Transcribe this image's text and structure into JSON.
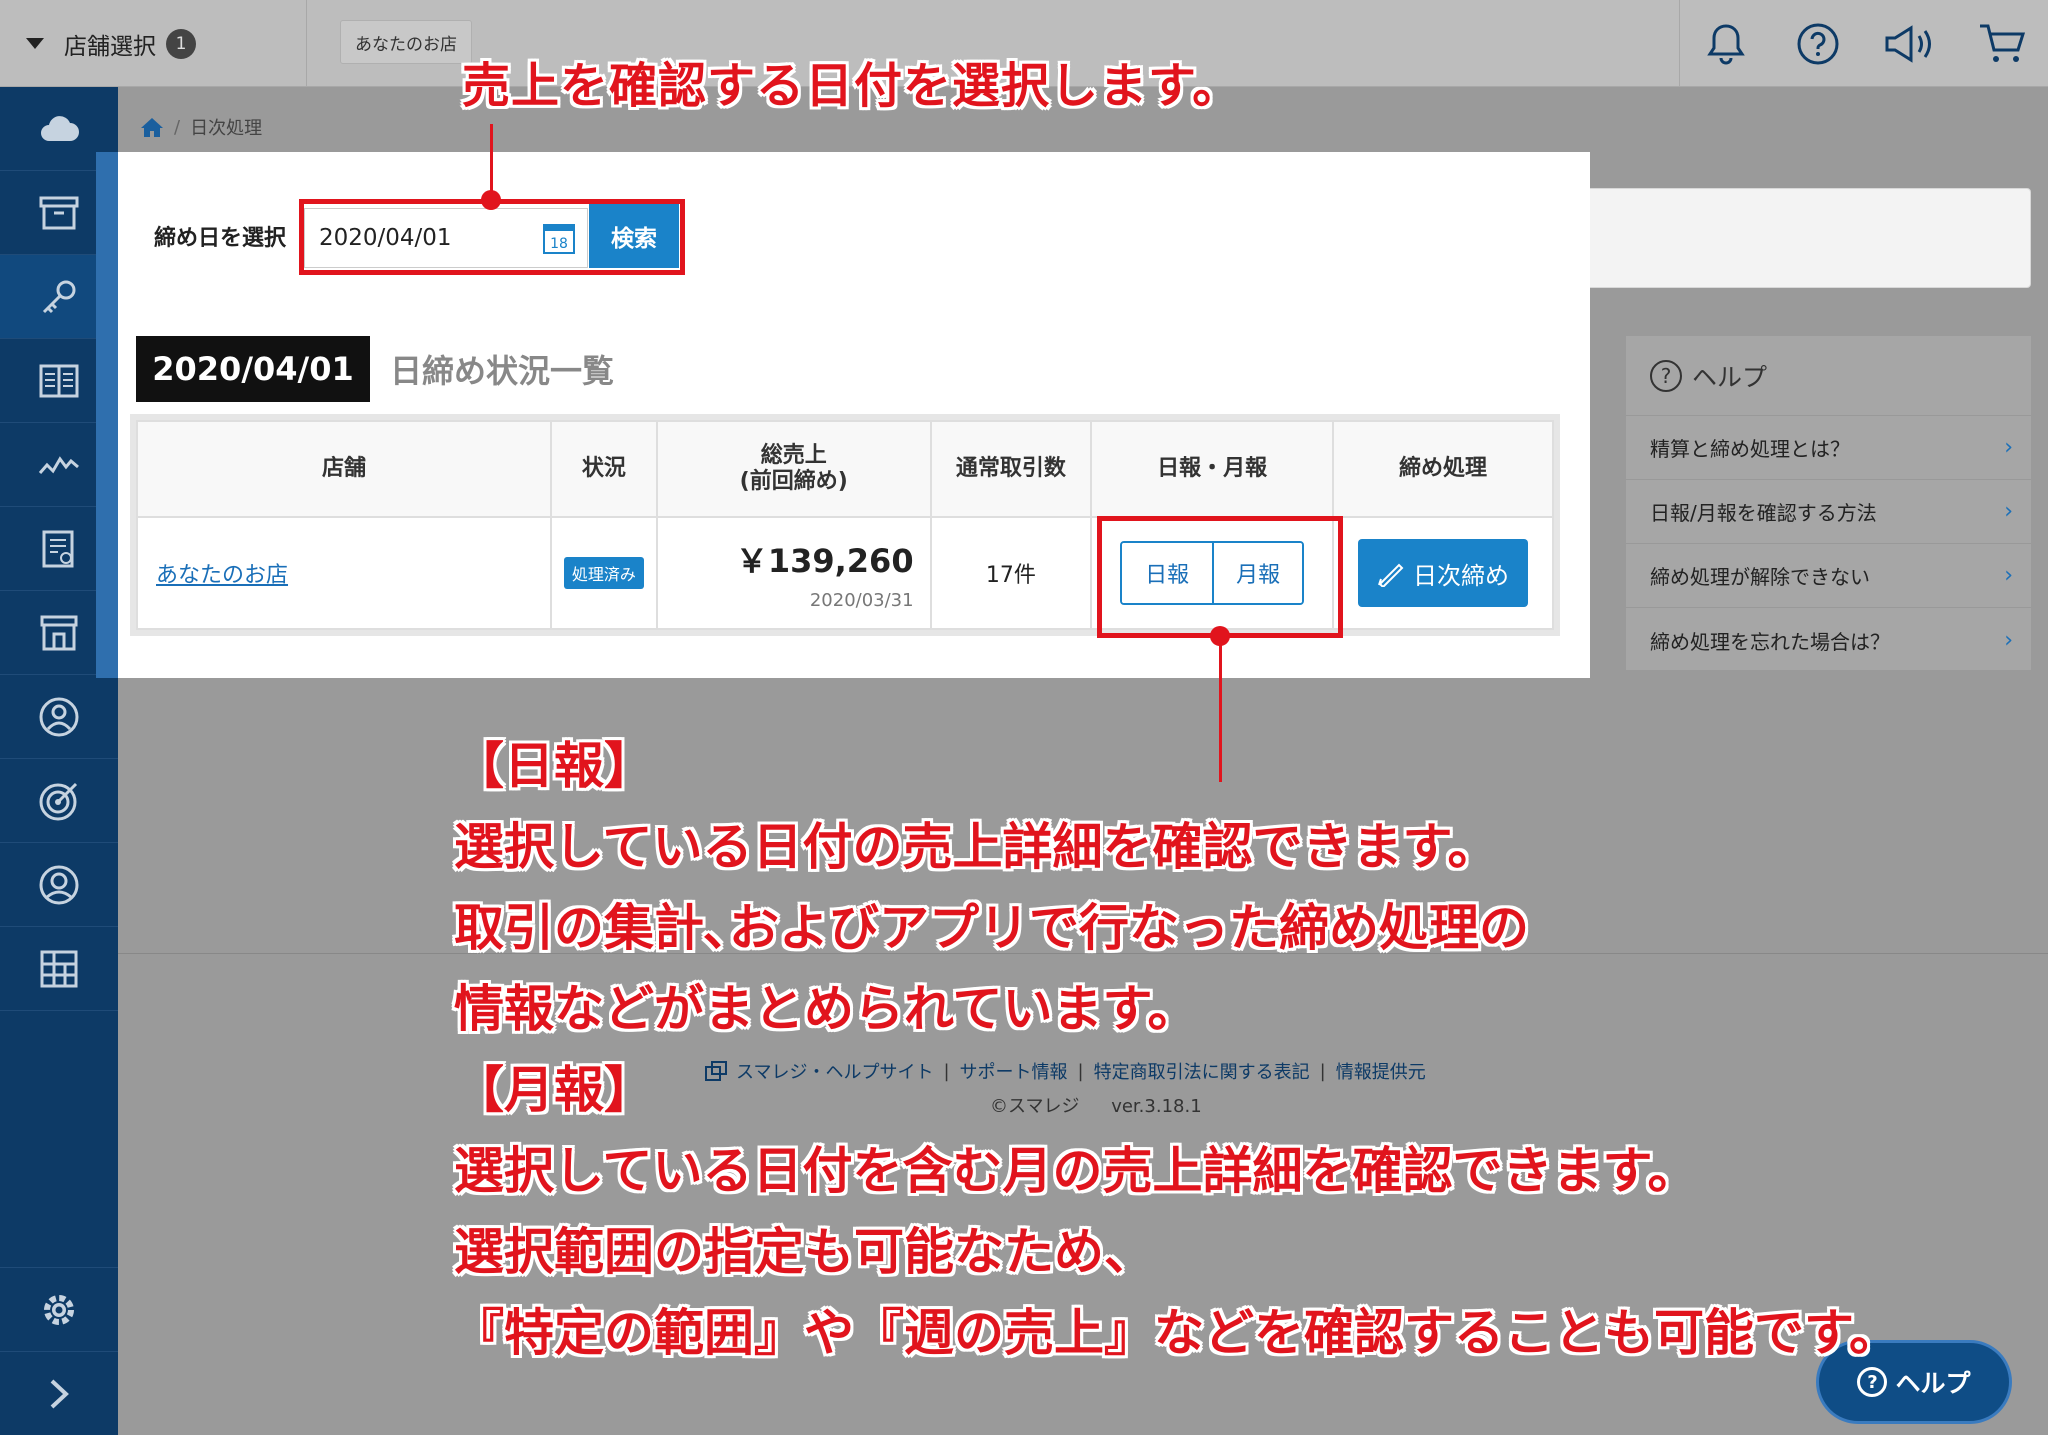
{
  "topbar": {
    "store_select_label": "店舗選択",
    "store_count": "1",
    "store_tab": "あなたのお店",
    "icons": [
      "bell-icon",
      "question-icon",
      "megaphone-icon",
      "cart-icon"
    ]
  },
  "sidebar": {
    "icons": [
      "cloud-icon",
      "archive-box-icon",
      "key-icon",
      "book-icon",
      "line-chart-icon",
      "report-icon",
      "store-icon",
      "person-circle-icon",
      "target-icon",
      "user-circle-icon",
      "grid-icon"
    ],
    "bottom_icons": [
      "gear-icon",
      "chevron-right-icon"
    ]
  },
  "breadcrumb": {
    "home": "home-icon",
    "current": "日次処理"
  },
  "filter": {
    "label": "締め日を選択",
    "date_value": "2020/04/01",
    "calendar_day": "18",
    "search_label": "検索"
  },
  "section": {
    "date": "2020/04/01",
    "title": "日締め状況一覧"
  },
  "table": {
    "headers": {
      "store": "店舗",
      "status": "状況",
      "sales_line1": "総売上",
      "sales_line2": "(前回締め)",
      "count": "通常取引数",
      "reports": "日報・月報",
      "closing": "締め処理"
    },
    "row": {
      "store": "あなたのお店",
      "status": "処理済み",
      "amount": "￥139,260",
      "prev_date": "2020/03/31",
      "count": "17件",
      "daily": "日報",
      "monthly": "月報",
      "close_button": "日次締め"
    }
  },
  "help_panel": {
    "title": "ヘルプ",
    "items": [
      "精算と締め処理とは？",
      "日報/月報を確認する方法",
      "締め処理が解除できない",
      "締め処理を忘れた場合は？"
    ]
  },
  "footer": {
    "links": [
      "スマレジ・ヘルプサイト",
      "サポート情報",
      "特定商取引法に関する表記",
      "情報提供元"
    ],
    "copyright": "©スマレジ",
    "version": "ver.3.18.1"
  },
  "help_fab": "ヘルプ",
  "annotations": {
    "top": "売上を確認する日付を選択します。",
    "body": [
      "【日報】",
      "選択している日付の売上詳細を確認できます。",
      "取引の集計､およびアプリで行なった締め処理の",
      "情報などがまとめられています。",
      "【月報】",
      "選択している日付を含む月の売上詳細を確認できます。",
      "選択範囲の指定も可能なため、",
      "『特定の範囲』や『週の売上』などを確認することも可能です。"
    ]
  },
  "colors": {
    "accent": "#1a83c9",
    "sidebar": "#0d3a66",
    "annotation": "#e1141d"
  }
}
